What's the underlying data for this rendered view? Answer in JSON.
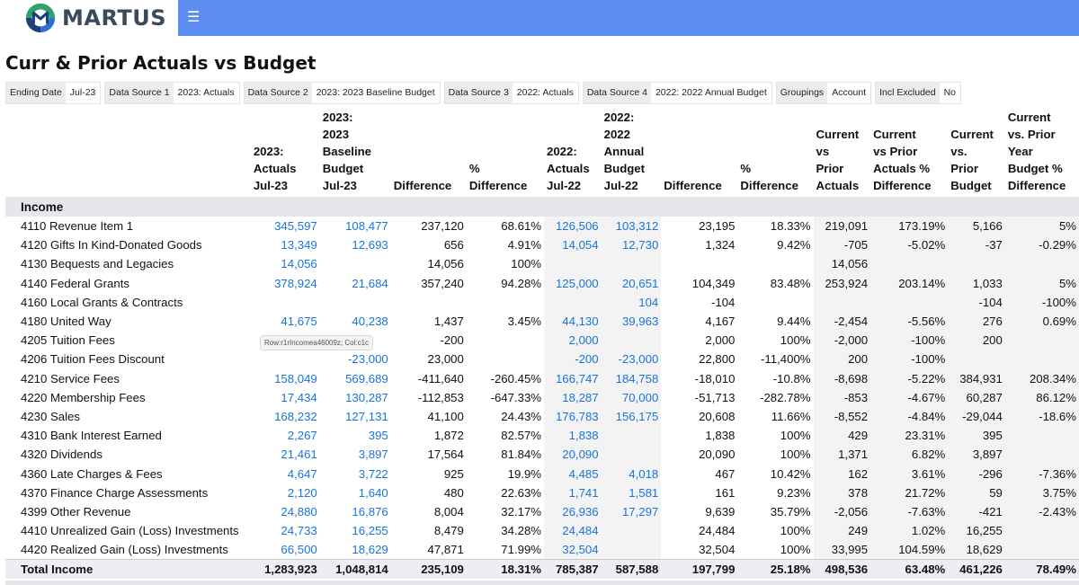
{
  "app": {
    "logo_text": "MARTUS",
    "menu_icon": "hamburger-icon"
  },
  "page": {
    "title": "Curr & Prior Actuals vs Budget"
  },
  "filters": [
    {
      "label": "Ending Date",
      "value": "Jul-23"
    },
    {
      "label": "Data Source 1",
      "value": "2023: Actuals"
    },
    {
      "label": "Data Source 2",
      "value": "2023: 2023 Baseline Budget"
    },
    {
      "label": "Data Source 3",
      "value": "2022: Actuals"
    },
    {
      "label": "Data Source 4",
      "value": "2022: 2022 Annual Budget"
    },
    {
      "label": "Groupings",
      "value": "Account"
    },
    {
      "label": "Incl Excluded",
      "value": "No"
    }
  ],
  "columns": [
    "",
    "2023:\nActuals\nJul-23",
    "2023:\n2023\nBaseline\nBudget\nJul-23",
    "Difference",
    "%\nDifference",
    "2022:\nActuals\nJul-22",
    "2022:\n2022\nAnnual\nBudget\nJul-22",
    "Difference",
    "%\nDifference",
    "Current\nvs\nPrior\nActuals",
    "Current\nvs Prior\nActuals %\nDifference",
    "Current\nvs.\nPrior\nBudget",
    "Current\nvs. Prior\nYear\nBudget %\nDifference"
  ],
  "section_label": "Income",
  "rows": [
    [
      "4110 Revenue Item 1",
      "345,597",
      "108,477",
      "237,120",
      "68.61%",
      "126,506",
      "103,312",
      "23,195",
      "18.33%",
      "219,091",
      "173.19%",
      "5,166",
      "5%"
    ],
    [
      "4120 Gifts In Kind-Donated Goods",
      "13,349",
      "12,693",
      "656",
      "4.91%",
      "14,054",
      "12,730",
      "1,324",
      "9.42%",
      "-705",
      "-5.02%",
      "-37",
      "-0.29%"
    ],
    [
      "4130 Bequests and Legacies",
      "14,056",
      "",
      "14,056",
      "100%",
      "",
      "",
      "",
      "",
      "14,056",
      "",
      "",
      ""
    ],
    [
      "4140 Federal Grants",
      "378,924",
      "21,684",
      "357,240",
      "94.28%",
      "125,000",
      "20,651",
      "104,349",
      "83.48%",
      "253,924",
      "203.14%",
      "1,033",
      "5%"
    ],
    [
      "4160 Local Grants & Contracts",
      "",
      "",
      "",
      "",
      "",
      "104",
      "-104",
      "",
      "",
      "",
      "-104",
      "-100%"
    ],
    [
      "4180 United Way",
      "41,675",
      "40,238",
      "1,437",
      "3.45%",
      "44,130",
      "39,963",
      "4,167",
      "9.44%",
      "-2,454",
      "-5.56%",
      "276",
      "0.69%"
    ],
    [
      "4205 Tuition Fees",
      "",
      "",
      "-200",
      "",
      "2,000",
      "",
      "2,000",
      "100%",
      "-2,000",
      "-100%",
      "200",
      ""
    ],
    [
      "4206 Tuition Fees Discount",
      "",
      "-23,000",
      "23,000",
      "",
      "-200",
      "-23,000",
      "22,800",
      "-11,400%",
      "200",
      "-100%",
      "",
      ""
    ],
    [
      "4210 Service Fees",
      "158,049",
      "569,689",
      "-411,640",
      "-260.45%",
      "166,747",
      "184,758",
      "-18,010",
      "-10.8%",
      "-8,698",
      "-5.22%",
      "384,931",
      "208.34%"
    ],
    [
      "4220 Membership Fees",
      "17,434",
      "130,287",
      "-112,853",
      "-647.33%",
      "18,287",
      "70,000",
      "-51,713",
      "-282.78%",
      "-853",
      "-4.67%",
      "60,287",
      "86.12%"
    ],
    [
      "4230 Sales",
      "168,232",
      "127,131",
      "41,100",
      "24.43%",
      "176,783",
      "156,175",
      "20,608",
      "11.66%",
      "-8,552",
      "-4.84%",
      "-29,044",
      "-18.6%"
    ],
    [
      "4310 Bank Interest Earned",
      "2,267",
      "395",
      "1,872",
      "82.57%",
      "1,838",
      "",
      "1,838",
      "100%",
      "429",
      "23.31%",
      "395",
      ""
    ],
    [
      "4320 Dividends",
      "21,461",
      "3,897",
      "17,564",
      "81.84%",
      "20,090",
      "",
      "20,090",
      "100%",
      "1,371",
      "6.82%",
      "3,897",
      ""
    ],
    [
      "4360 Late Charges & Fees",
      "4,647",
      "3,722",
      "925",
      "19.9%",
      "4,485",
      "4,018",
      "467",
      "10.42%",
      "162",
      "3.61%",
      "-296",
      "-7.36%"
    ],
    [
      "4370 Finance Charge Assessments",
      "2,120",
      "1,640",
      "480",
      "22.63%",
      "1,741",
      "1,581",
      "161",
      "9.23%",
      "378",
      "21.72%",
      "59",
      "3.75%"
    ],
    [
      "4399 Other Revenue",
      "24,880",
      "16,876",
      "8,004",
      "32.17%",
      "26,936",
      "17,297",
      "9,639",
      "35.79%",
      "-2,056",
      "-7.63%",
      "-421",
      "-2.43%"
    ],
    [
      "4410 Unrealized Gain (Loss) Investments",
      "24,733",
      "16,255",
      "8,479",
      "34.28%",
      "24,484",
      "",
      "24,484",
      "100%",
      "249",
      "1.02%",
      "16,255",
      ""
    ],
    [
      "4420 Realized Gain (Loss) Investments",
      "66,500",
      "18,629",
      "47,871",
      "71.99%",
      "32,504",
      "",
      "32,504",
      "100%",
      "33,995",
      "104.59%",
      "18,629",
      ""
    ]
  ],
  "total": [
    "Total Income",
    "1,283,923",
    "1,048,814",
    "235,109",
    "18.31%",
    "785,387",
    "587,588",
    "197,799",
    "25.18%",
    "498,536",
    "63.48%",
    "461,226",
    "78.49%"
  ],
  "tooltip": "Row:r1rIncomea46009z; Col:c1c",
  "colors": {
    "accent_bar": "#5b8ef0",
    "link": "#1a73d9",
    "section_bg": "#e6e7ea"
  }
}
